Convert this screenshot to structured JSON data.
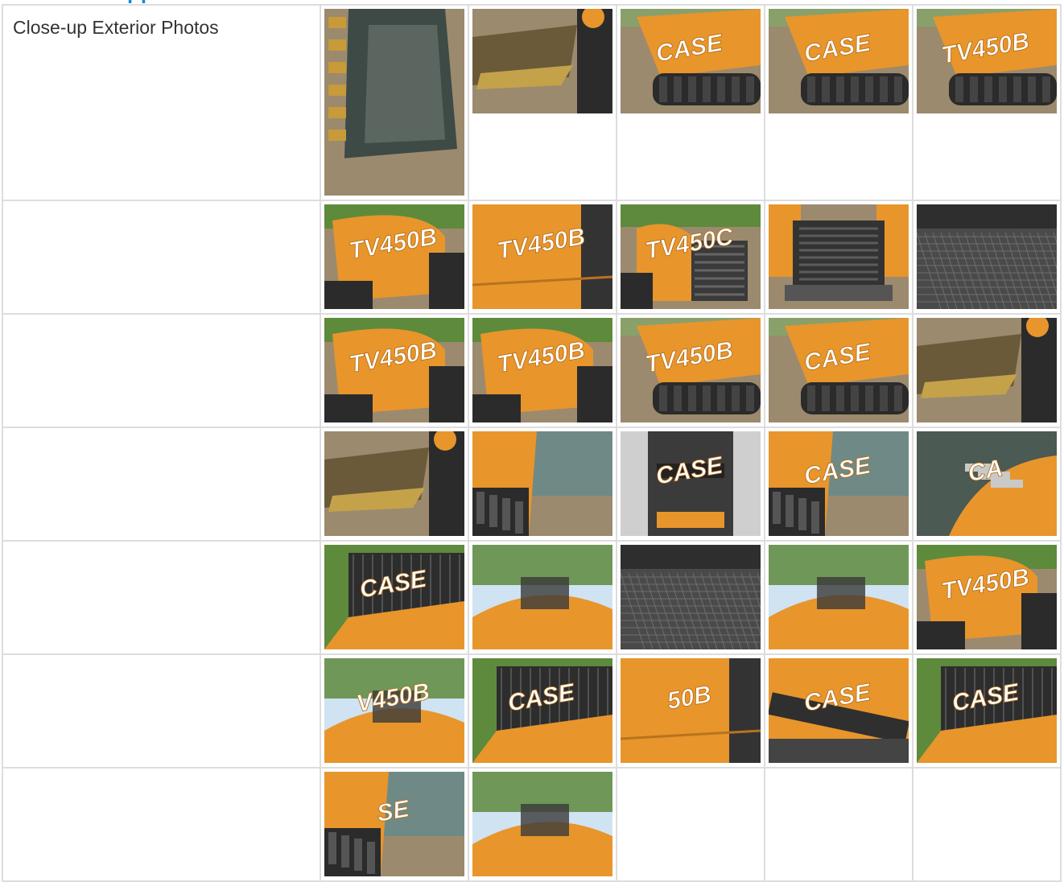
{
  "header_fragment": {
    "text": "pp"
  },
  "section": {
    "label": "Close-up Exterior Photos"
  },
  "colors": {
    "machine_orange": "#e8952c",
    "dirt": "#9c8a6e",
    "track_black": "#2b2b2b",
    "foliage": "#5e8a3c",
    "sky": "#cfe3f2",
    "steel": "#5a5a5a"
  },
  "rows": [
    {
      "photos": [
        {
          "name": "bucket-teeth-photo",
          "scene": "bucket",
          "text": "",
          "tall": true
        },
        {
          "name": "bucket-ground-photo",
          "scene": "bucket-low",
          "text": ""
        },
        {
          "name": "loader-case-side-photo",
          "scene": "side",
          "text": "CASE"
        },
        {
          "name": "loader-case-track-photo",
          "scene": "side",
          "text": "CASE"
        },
        {
          "name": "loader-rear-model-photo",
          "scene": "side",
          "text": "TV450B"
        }
      ]
    },
    {
      "photos": [
        {
          "name": "rear-fender-model-photo",
          "scene": "fender",
          "text": "TV450B"
        },
        {
          "name": "rear-fender-closeup-photo",
          "scene": "fender-close",
          "text": "TV450B"
        },
        {
          "name": "rear-grille-photo",
          "scene": "grille",
          "text": "TV450C"
        },
        {
          "name": "rear-grille-center-photo",
          "scene": "grille-center",
          "text": ""
        },
        {
          "name": "rear-step-grate-photo",
          "scene": "grate",
          "text": ""
        }
      ]
    },
    {
      "photos": [
        {
          "name": "rear-corner-model-photo",
          "scene": "fender",
          "text": "TV450B"
        },
        {
          "name": "side-fender-model-photo",
          "scene": "fender",
          "text": "TV450B"
        },
        {
          "name": "side-track-model-photo",
          "scene": "side",
          "text": "TV450B"
        },
        {
          "name": "side-track-case-photo",
          "scene": "side",
          "text": "CASE"
        },
        {
          "name": "front-track-bucket-photo",
          "scene": "bucket-low",
          "text": ""
        }
      ]
    },
    {
      "photos": [
        {
          "name": "bucket-arm-photo",
          "scene": "bucket-low",
          "text": ""
        },
        {
          "name": "cab-door-open-photo",
          "scene": "cab",
          "text": ""
        },
        {
          "name": "cab-entry-photo",
          "scene": "entry",
          "text": "CASE"
        },
        {
          "name": "loader-arm-case-photo",
          "scene": "cab",
          "text": "CASE"
        },
        {
          "name": "hydraulic-couplers-photo",
          "scene": "hoses",
          "text": "CA"
        }
      ]
    },
    {
      "photos": [
        {
          "name": "cab-cage-case-photo",
          "scene": "cage",
          "text": "CASE"
        },
        {
          "name": "roof-trees-photo",
          "scene": "roof",
          "text": ""
        },
        {
          "name": "engine-grate-photo",
          "scene": "grate",
          "text": ""
        },
        {
          "name": "exhaust-stack-photo",
          "scene": "roof",
          "text": ""
        },
        {
          "name": "rear-light-model-photo",
          "scene": "fender",
          "text": "TV450B"
        }
      ]
    },
    {
      "photos": [
        {
          "name": "top-fender-model-photo",
          "scene": "roof",
          "text": "V450B"
        },
        {
          "name": "top-case-side-photo",
          "scene": "cage",
          "text": "CASE"
        },
        {
          "name": "side-panel-model-photo",
          "scene": "fender-close",
          "text": "50B"
        },
        {
          "name": "arm-case-closeup-photo",
          "scene": "arm",
          "text": "CASE"
        },
        {
          "name": "cage-case-trees-photo",
          "scene": "cage",
          "text": "CASE"
        }
      ]
    },
    {
      "photos": [
        {
          "name": "track-case-lower-photo",
          "scene": "cab",
          "text": "SE"
        },
        {
          "name": "cab-rear-trees-photo",
          "scene": "roof",
          "text": ""
        }
      ]
    }
  ]
}
